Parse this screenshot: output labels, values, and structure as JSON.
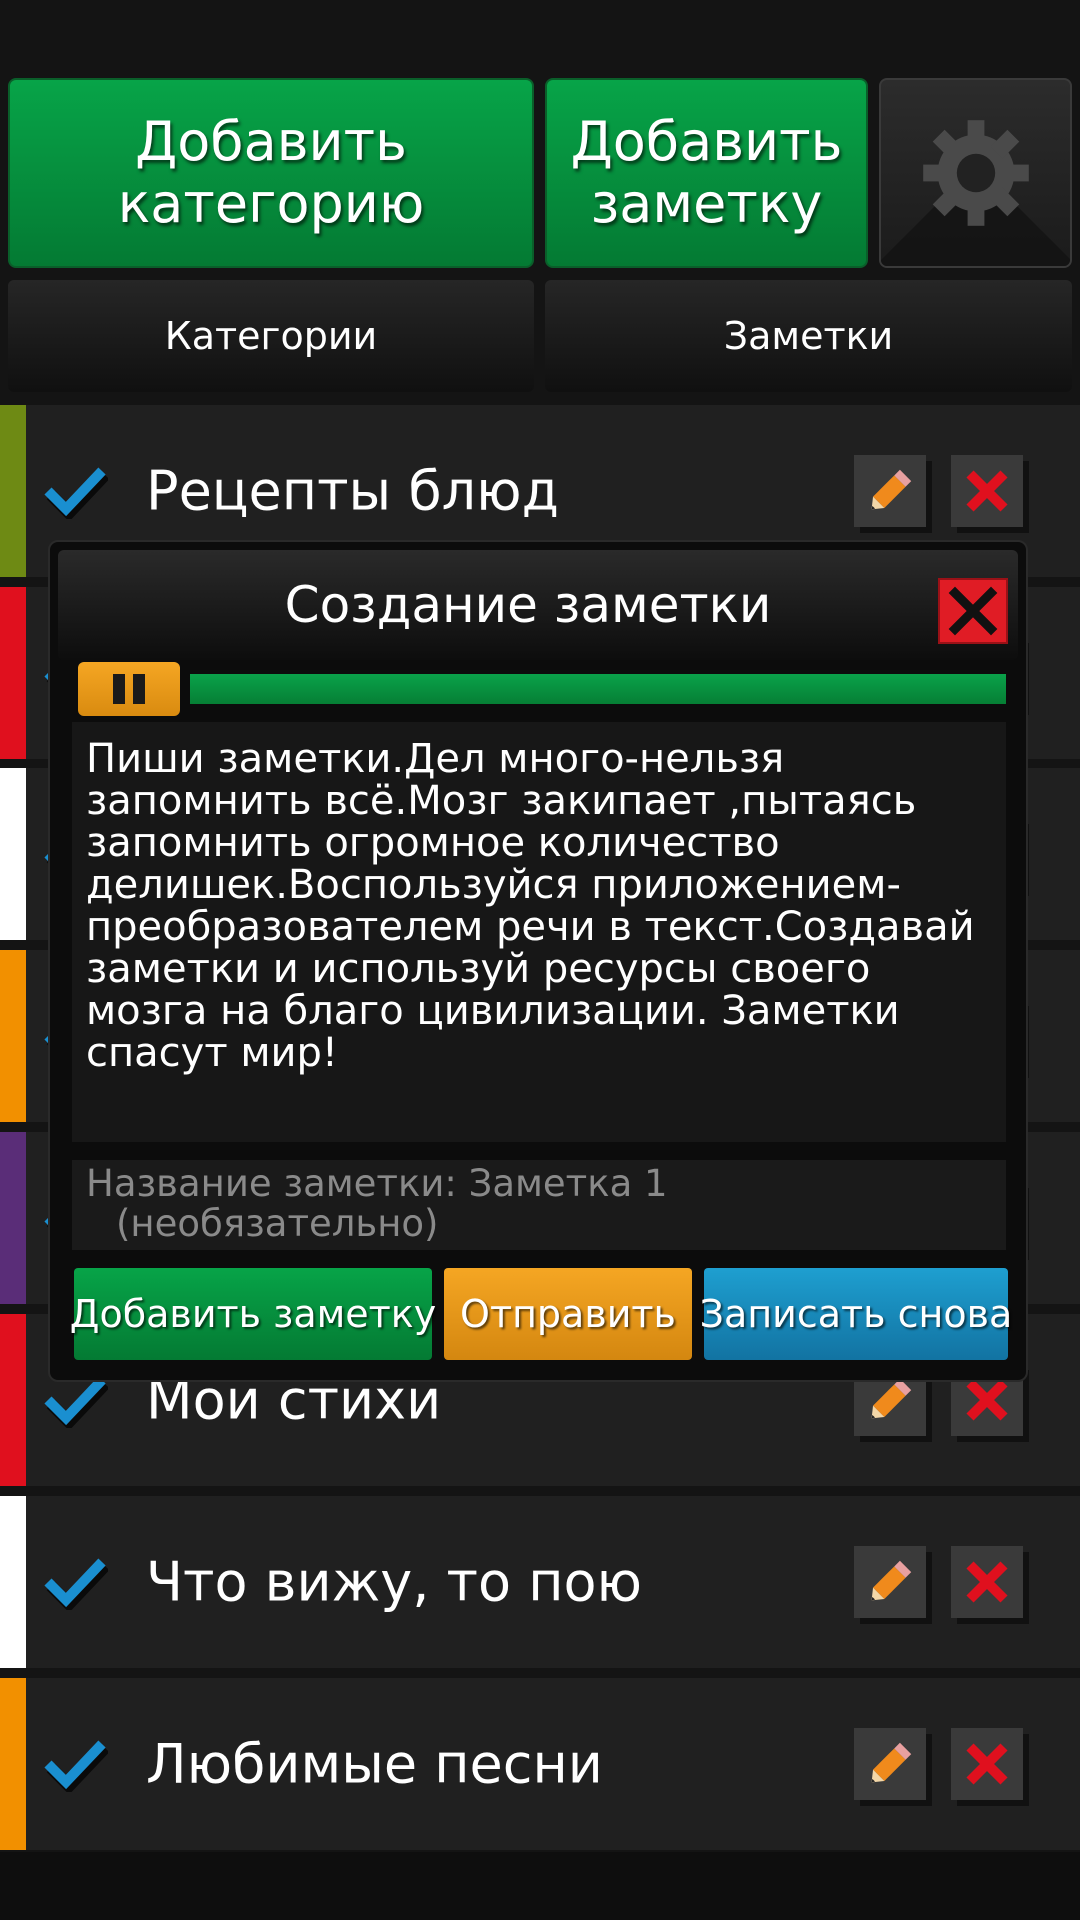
{
  "toolbar": {
    "add_category_label": "Добавить\nкатегорию",
    "add_note_label": "Добавить\nзаметку",
    "settings_icon": "gear-icon"
  },
  "tabs": {
    "categories": "Категории",
    "notes": "Заметки"
  },
  "categories": [
    {
      "label": "Рецепты блюд",
      "color": "#6e8a14"
    },
    {
      "label": "",
      "color": "#e0101e"
    },
    {
      "label": "",
      "color": "#ffffff"
    },
    {
      "label": "",
      "color": "#f29000"
    },
    {
      "label": "",
      "color": "#5a2d78"
    },
    {
      "label": "Мои стихи",
      "color": "#e0101e"
    },
    {
      "label": "Что вижу, то пою",
      "color": "#ffffff"
    },
    {
      "label": "Любимые песни",
      "color": "#f29000"
    }
  ],
  "dialog": {
    "title": "Создание заметки",
    "progress_percent": 100,
    "note_text": "Пиши заметки.Дел  много-нельзя запомнить всё.Мозг закипает ,пытаясь запомнить огромное количество делишек.Воспользуйся приложением-преобразователем речи в текст.Создавай заметки и используй ресурсы своего мозга на благо цивилизации. Заметки спасут мир!",
    "title_field_label": "Название заметки: Заметка 1",
    "title_field_hint": "(необязательно)",
    "add_button": "Добавить заметку",
    "send_button": "Отправить",
    "record_button": "Записать снова"
  },
  "colors": {
    "green": "#07a448",
    "orange": "#f5a623",
    "blue": "#1e9fd0",
    "red": "#e01c25",
    "check_blue": "#1a8fd0"
  }
}
